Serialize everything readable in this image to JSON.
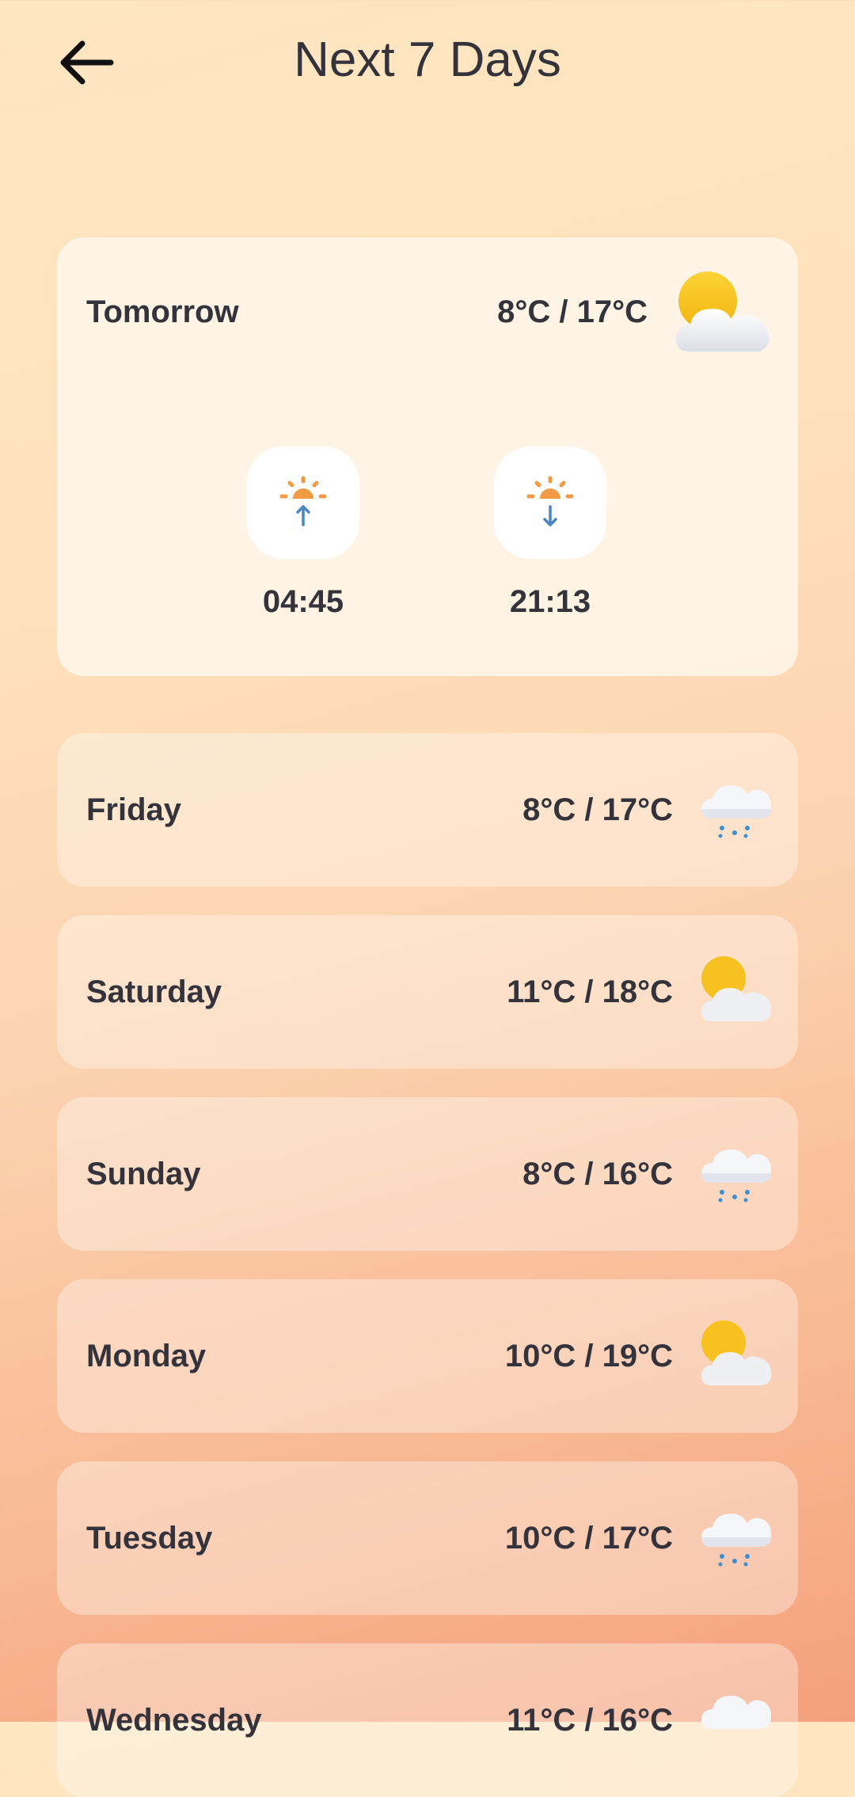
{
  "header": {
    "title": "Next 7 Days",
    "back_icon": "arrow-left-icon"
  },
  "tomorrow": {
    "label": "Tomorrow",
    "temp": "8°C / 17°C",
    "icon": "partly-cloudy-icon",
    "sunrise": {
      "icon": "sunrise-icon",
      "time": "04:45"
    },
    "sunset": {
      "icon": "sunset-icon",
      "time": "21:13"
    }
  },
  "days": [
    {
      "label": "Friday",
      "temp": "8°C / 17°C",
      "icon": "rain-cloud-icon"
    },
    {
      "label": "Saturday",
      "temp": "11°C / 18°C",
      "icon": "partly-cloudy-icon"
    },
    {
      "label": "Sunday",
      "temp": "8°C / 16°C",
      "icon": "rain-cloud-icon"
    },
    {
      "label": "Monday",
      "temp": "10°C / 19°C",
      "icon": "partly-cloudy-icon"
    },
    {
      "label": "Tuesday",
      "temp": "10°C / 17°C",
      "icon": "rain-cloud-icon"
    },
    {
      "label": "Wednesday",
      "temp": "11°C / 16°C",
      "icon": "cloud-icon"
    }
  ],
  "colors": {
    "text": "#34333c",
    "sun": "#f7c21f",
    "sunrise_orange": "#f39a45",
    "arrow_blue": "#4a86c5",
    "rain_blue": "#3d8fd3"
  }
}
